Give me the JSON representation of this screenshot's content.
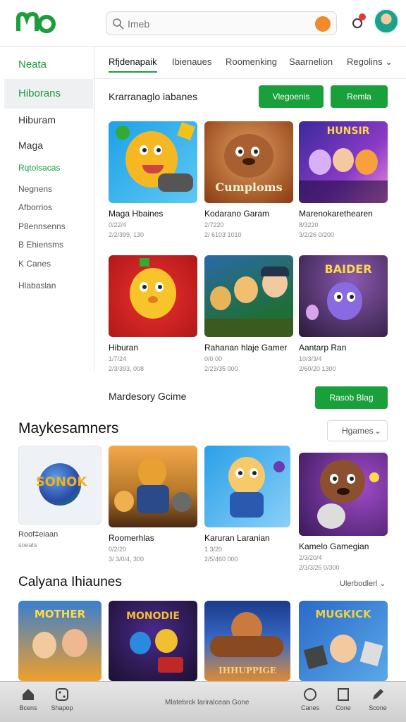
{
  "header": {
    "logo_text": "Mo",
    "search_placeholder": "Imeb"
  },
  "sidebar": {
    "items": [
      {
        "label": "Neata"
      },
      {
        "label": "Hiborans"
      },
      {
        "label": "Hiburam"
      },
      {
        "label": "Maga"
      },
      {
        "label": "Rqtolsacas"
      },
      {
        "label": "Negnens"
      },
      {
        "label": "Afborrios"
      },
      {
        "label": "P8ennsenns"
      },
      {
        "label": "B Ehiensms"
      },
      {
        "label": "K Canes"
      },
      {
        "label": "Hlabaslan"
      }
    ]
  },
  "tabs": [
    {
      "label": "Rfjdenapaik"
    },
    {
      "label": "Ibienaues"
    },
    {
      "label": "Roomenking"
    },
    {
      "label": "Saarnelion"
    },
    {
      "label": "Regolins"
    }
  ],
  "section1": {
    "heading": "Krarranaglo iabanes",
    "btn1": "Vlegoenis",
    "btn2": "Remla"
  },
  "grid1": [
    {
      "title": "Maga Hbaines",
      "meta1": "0/22/4",
      "meta2": "2/2/399, 130",
      "colors": [
        "#1da1e6",
        "#f5b823"
      ]
    },
    {
      "title": "Kodarano Garam",
      "meta1": "2/7220",
      "meta2": "2/ 6103 1010",
      "thumb_text": "Cumploms",
      "colors": [
        "#8a3a12",
        "#e0a060"
      ]
    },
    {
      "title": "Marenokarethearen",
      "meta1": "8/3220",
      "meta2": "3/2/26 0/200",
      "thumb_text": "HUNSIR",
      "colors": [
        "#3a2a9a",
        "#f08bd8"
      ]
    },
    {
      "title": "Hiburan",
      "meta1": "1/7/24",
      "meta2": "2/3/393, 008",
      "colors": [
        "#d4201f",
        "#f7c52a"
      ]
    },
    {
      "title": "Rahanan hlaje Gamer",
      "meta1": "0/0 00",
      "meta2": "2/23/35 000",
      "colors": [
        "#1f6e3a",
        "#e8b45a"
      ]
    },
    {
      "title": "Aantarp Ran",
      "meta1": "10/3/3/4",
      "meta2": "2/60/20 1300",
      "thumb_text": "BAIDER",
      "colors": [
        "#4a2c6a",
        "#d8a3e8"
      ]
    }
  ],
  "section2": {
    "heading": "Mardesory Gcime",
    "btn": "Rasob Blag"
  },
  "section3": {
    "title": "Maykesamners",
    "dropdown": "Hgames"
  },
  "grid2": [
    {
      "title": "Roof‡eiaan",
      "meta1": "soeats",
      "meta2": "",
      "thumb_text": "SONOK",
      "colors": [
        "#eef2f7",
        "#2a7fd0"
      ]
    },
    {
      "title": "Roomerhlas",
      "meta1": "0/2/20",
      "meta2": "3/ 3/0/4, 300",
      "colors": [
        "#b87a2a",
        "#4a2a12"
      ]
    },
    {
      "title": "Karuran Laranian",
      "meta1": "1 3/20",
      "meta2": "2/5/460 000",
      "colors": [
        "#2aa0e8",
        "#f6c96a"
      ]
    },
    {
      "title": "Kamelo Gamegian",
      "meta1": "2/3/20/4",
      "meta2": "2/3/3/26 0/300",
      "colors": [
        "#3a1a5a",
        "#8a5030"
      ]
    }
  ],
  "section4": {
    "title": "Calyana Ihiaunes",
    "dropdown": "Ulerbodlerl"
  },
  "grid3": [
    {
      "thumb_text": "MOTHER",
      "colors": [
        "#f0a028",
        "#3a7fd0"
      ]
    },
    {
      "thumb_text": "MONODIE",
      "colors": [
        "#1a1030",
        "#f0c030"
      ]
    },
    {
      "thumb_text": "IHHUPPIGE",
      "colors": [
        "#1a3a8a",
        "#e08a30"
      ]
    },
    {
      "thumb_text": "MUGKICK",
      "colors": [
        "#2a6ac8",
        "#f0d040"
      ]
    }
  ],
  "bottom_bar": {
    "center_text": "Mlatebrck lariralcean Gone",
    "items": [
      {
        "label": "Bcens",
        "icon": "home-icon"
      },
      {
        "label": "Shapop",
        "icon": "dice-icon"
      },
      {
        "label": "Canes",
        "icon": "clock-icon"
      },
      {
        "label": "Cone",
        "icon": "panel-icon"
      },
      {
        "label": "Scone",
        "icon": "pen-icon"
      }
    ]
  },
  "accent_green": "#19a03a"
}
